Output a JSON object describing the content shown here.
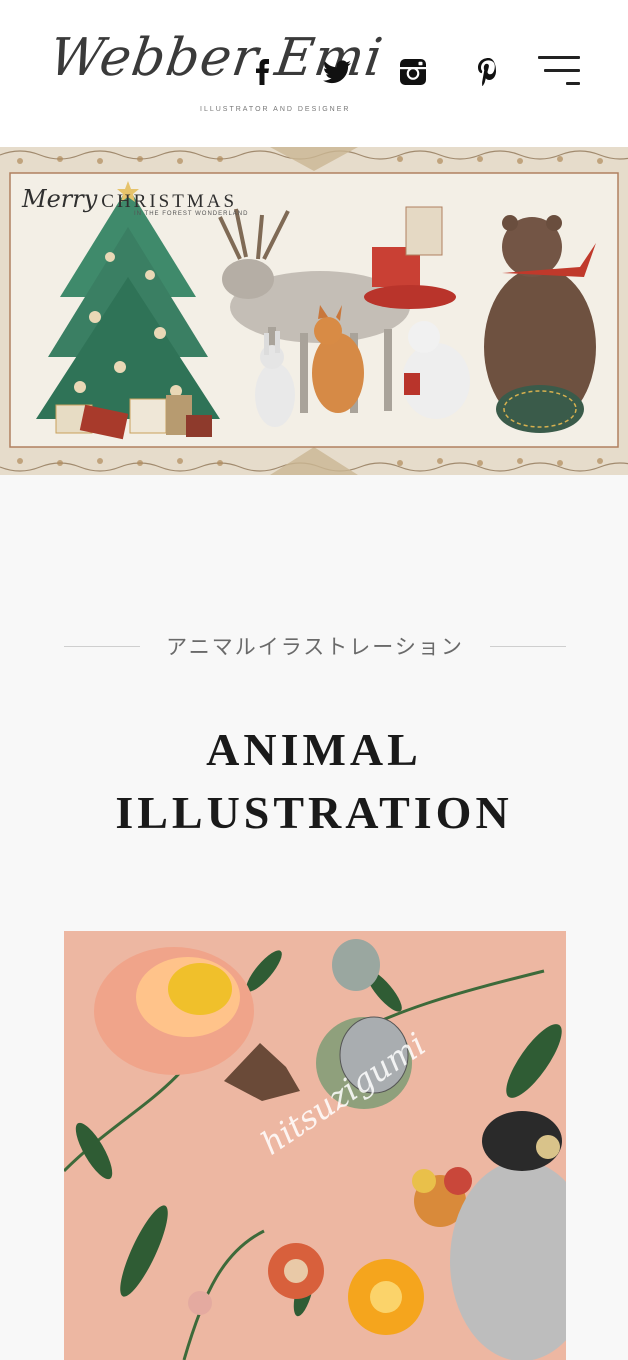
{
  "header": {
    "logo_text": "Webber Emi",
    "logo_tagline": "ILLUSTRATOR AND DESIGNER",
    "social": [
      {
        "icon": "facebook-icon"
      },
      {
        "icon": "twitter-icon"
      },
      {
        "icon": "instagram-icon"
      },
      {
        "icon": "pinterest-icon"
      }
    ],
    "menu_icon": "hamburger-menu-icon"
  },
  "banner": {
    "script": "Merry",
    "title": "CHRISTMAS",
    "subtitle": "IN THE FOREST WONDERLAND"
  },
  "section": {
    "subtitle": "アニマルイラストレーション",
    "title_line1": "ANIMAL",
    "title_line2": "ILLUSTRATION"
  },
  "artwork": {
    "script_text": "hitsuzigumi"
  },
  "colors": {
    "page_bg": "#f8f8f8",
    "header_bg": "#ffffff",
    "text_dark": "#1a1a1a",
    "subtitle_gray": "#6a6a6a",
    "art_bg": "#edb7a2"
  }
}
